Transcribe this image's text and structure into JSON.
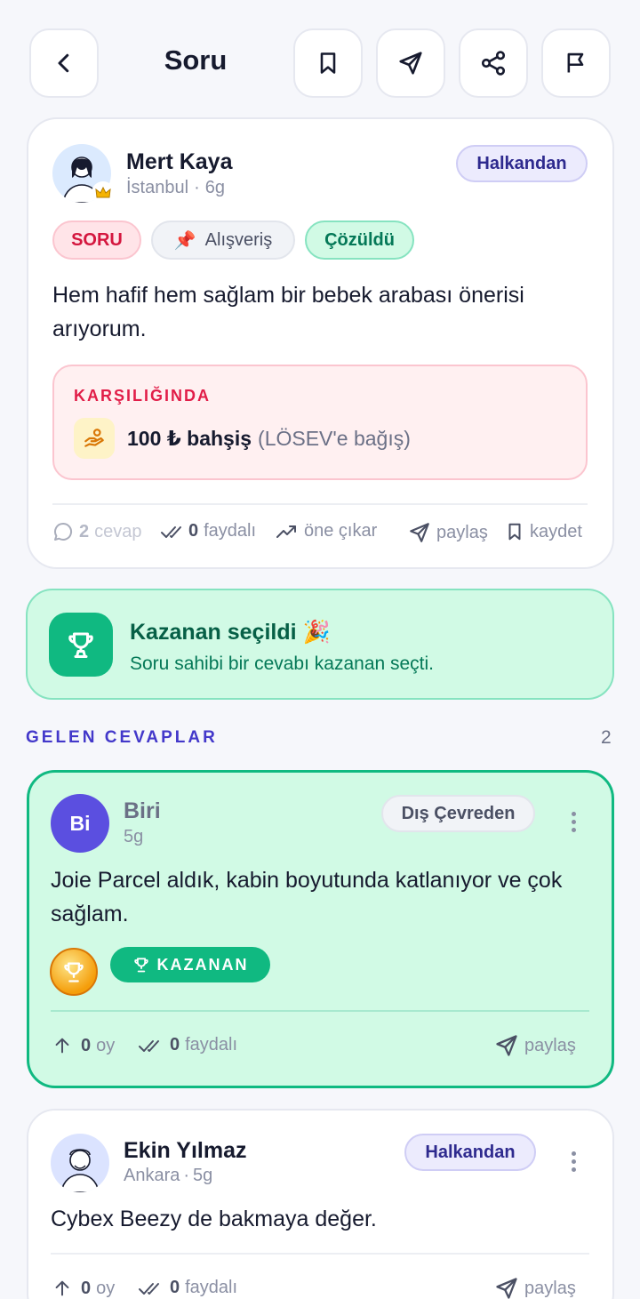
{
  "header": {
    "title": "Soru",
    "icons": [
      "back-icon",
      "bookmark-icon",
      "send-icon",
      "share-icon",
      "flag-icon"
    ]
  },
  "question": {
    "author": "Mert Kaya",
    "location": "İstanbul",
    "sep": "·",
    "age": "6g",
    "badge": "Halkandan",
    "tags": {
      "type": "SORU",
      "category_icon": "📌",
      "category": "Alışveriş",
      "status": "Çözüldü"
    },
    "text": "Hem hafif hem sağlam bir bebek arabası önerisi arıyorum.",
    "reward": {
      "heading": "KARŞILIĞINDA",
      "amount": "100 ₺ bahşiş",
      "note": "(LÖSEV'e bağış)"
    },
    "actions": {
      "answers_count": "2",
      "answers_label": "cevap",
      "helpful_count": "0",
      "helpful_label": "faydalı",
      "promote": "öne çıkar",
      "share": "paylaş",
      "save": "kaydet"
    }
  },
  "winner_banner": {
    "title": "Kazanan seçildi 🎉",
    "subtitle": "Soru sahibi bir cevabı kazanan seçti."
  },
  "answers_section": {
    "heading": "GELEN CEVAPLAR",
    "count": "2"
  },
  "answers": [
    {
      "initials": "Bi",
      "author": "Biri",
      "age": "5g",
      "badge": "Dış Çevreden",
      "text": "Joie Parcel aldık, kabin boyutunda katlanıyor ve çok sağlam.",
      "winner_label": "KAZANAN",
      "votes": "0",
      "votes_label": "oy",
      "helpful": "0",
      "helpful_label": "faydalı",
      "share": "paylaş"
    },
    {
      "author": "Ekin Yılmaz",
      "location": "Ankara",
      "sep": "·",
      "age": "5g",
      "badge": "Halkandan",
      "text": "Cybex Beezy de bakmaya değer.",
      "votes": "0",
      "votes_label": "oy",
      "helpful": "0",
      "helpful_label": "faydalı",
      "share": "paylaş"
    }
  ],
  "colors": {
    "accent_purple": "#4338ca",
    "winner_green": "#10b981",
    "winner_bg": "#d1fae5",
    "reward_red": "#e11d48"
  }
}
